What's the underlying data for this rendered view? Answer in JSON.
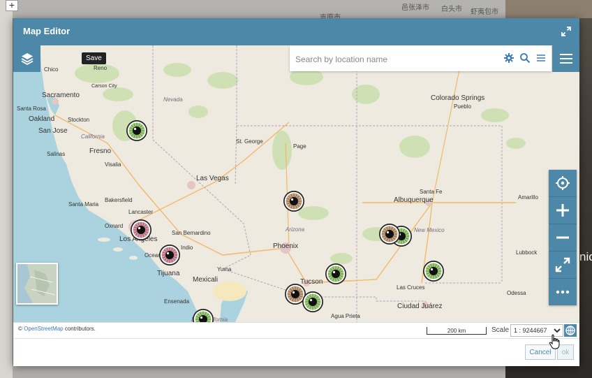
{
  "background": {
    "tail_text": "nic",
    "cjk_labels": [
      "邑张泽市",
      "白头市",
      "虾夷包市",
      "吉原市"
    ]
  },
  "window": {
    "title": "Map Editor"
  },
  "toolbar": {
    "save_tooltip": "Save"
  },
  "search": {
    "placeholder": "Search by location name"
  },
  "map_labels": [
    {
      "id": "chico",
      "text": "Chico"
    },
    {
      "id": "reno",
      "text": "Reno"
    },
    {
      "id": "carson",
      "text": "Carson City"
    },
    {
      "id": "sacramento",
      "text": "Sacramento"
    },
    {
      "id": "nevada",
      "text": "Nevada"
    },
    {
      "id": "santarosa",
      "text": "Santa Rosa"
    },
    {
      "id": "oakland",
      "text": "Oakland"
    },
    {
      "id": "stockton",
      "text": "Stockton"
    },
    {
      "id": "sanjose",
      "text": "San Jose"
    },
    {
      "id": "california",
      "text": "California"
    },
    {
      "id": "fresno",
      "text": "Fresno"
    },
    {
      "id": "salinas",
      "text": "Salinas"
    },
    {
      "id": "visalia",
      "text": "Visalia"
    },
    {
      "id": "stgeorge",
      "text": "St. George"
    },
    {
      "id": "page",
      "text": "Page"
    },
    {
      "id": "lasvegas",
      "text": "Las Vegas"
    },
    {
      "id": "bakersfield",
      "text": "Bakersfield"
    },
    {
      "id": "santamaria",
      "text": "Santa Maria"
    },
    {
      "id": "lancaster",
      "text": "Lancaster"
    },
    {
      "id": "oxnard",
      "text": "Oxnard"
    },
    {
      "id": "losangeles",
      "text": "Los Angeles"
    },
    {
      "id": "sanbernardino",
      "text": "San Bernardino"
    },
    {
      "id": "indio",
      "text": "Indio"
    },
    {
      "id": "oceanside",
      "text": "Oceanside"
    },
    {
      "id": "arizona",
      "text": "Arizona"
    },
    {
      "id": "phoenix",
      "text": "Phoenix"
    },
    {
      "id": "yuma",
      "text": "Yuma"
    },
    {
      "id": "tijuana",
      "text": "Tijuana"
    },
    {
      "id": "mexicali",
      "text": "Mexicali"
    },
    {
      "id": "ensenada",
      "text": "Ensenada"
    },
    {
      "id": "tucson",
      "text": "Tucson"
    },
    {
      "id": "aguaprieta",
      "text": "Agua Prieta"
    },
    {
      "id": "bajacalifornia",
      "text": "Baja California"
    },
    {
      "id": "coloradosprings",
      "text": "Colorado Springs"
    },
    {
      "id": "pueblo",
      "text": "Pueblo"
    },
    {
      "id": "santafe",
      "text": "Santa Fe"
    },
    {
      "id": "albuquerque",
      "text": "Albuquerque"
    },
    {
      "id": "amarillo",
      "text": "Amarillo"
    },
    {
      "id": "newmexico",
      "text": "New Mexico"
    },
    {
      "id": "lubbock",
      "text": "Lubbock"
    },
    {
      "id": "lascruces",
      "text": "Las Cruces"
    },
    {
      "id": "ciudadjuarez",
      "text": "Ciudad Juárez"
    },
    {
      "id": "odessa",
      "text": "Odessa"
    }
  ],
  "markers": [
    {
      "id": "m1",
      "color": "#9fd07a"
    },
    {
      "id": "m2",
      "color": "#c9a47f"
    },
    {
      "id": "m3",
      "color": "#d995a8"
    },
    {
      "id": "m4",
      "color": "#d995a8"
    },
    {
      "id": "m5",
      "color": "#9fd07a"
    },
    {
      "id": "m6",
      "color": "#c9a47f"
    },
    {
      "id": "m7",
      "color": "#9fd07a"
    },
    {
      "id": "m8",
      "color": "#9fd07a"
    },
    {
      "id": "m9",
      "color": "#c9a47f"
    },
    {
      "id": "m10",
      "color": "#9fd07a"
    },
    {
      "id": "m11",
      "color": "#9fd07a"
    }
  ],
  "status": {
    "attribution_prefix": "©",
    "attribution_link": "OpenStreetMap",
    "attribution_suffix": "contributors.",
    "scalebar": "200 km",
    "scale_label": "Scale",
    "scale_value": "1 : 9244667"
  },
  "footer": {
    "cancel": "Cancel",
    "ok": "ok"
  },
  "colors": {
    "header": "#4d88a8",
    "water": "#aad3df",
    "land": "#efeadf"
  }
}
